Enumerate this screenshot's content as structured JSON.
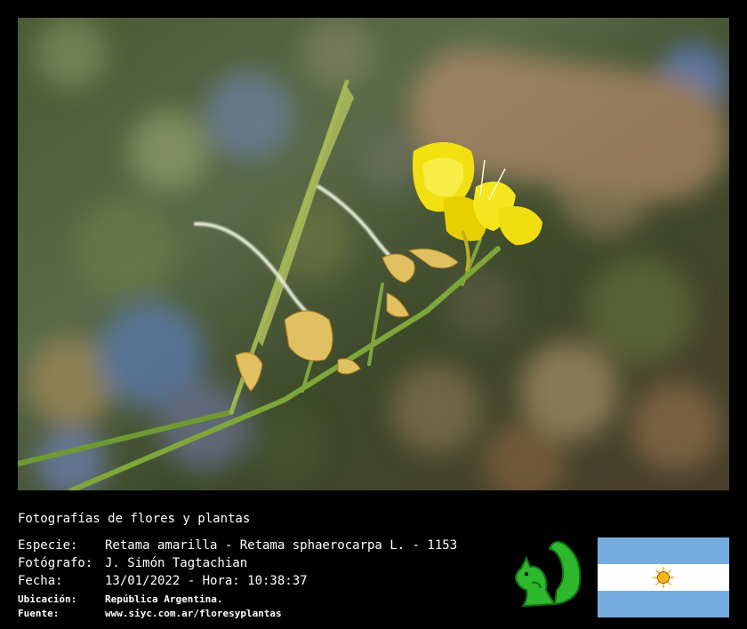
{
  "title": "Fotografías de flores y plantas",
  "fields": [
    {
      "label": "Especie:",
      "value": "Retama amarilla - Retama sphaerocarpa L. - 1153"
    },
    {
      "label": "Fotógrafo:",
      "value": "J. Simón Tagtachian"
    },
    {
      "label": "Fecha:",
      "value": "13/01/2022 - Hora: 10:38:37"
    },
    {
      "label": "Ubicación:",
      "value": "República Argentina."
    },
    {
      "label": "Fuente:",
      "value": "www.siyc.com.ar/floresyplantas"
    }
  ],
  "colors": {
    "flower_yellow": "#f2e010",
    "stem_green": "#7ea63a",
    "logo_green": "#2db82d",
    "flag_blue": "#74acdf",
    "sun": "#f6b40e"
  },
  "icons": {
    "logo": "squirrel-logo-icon",
    "flag": "argentina-flag-icon"
  }
}
